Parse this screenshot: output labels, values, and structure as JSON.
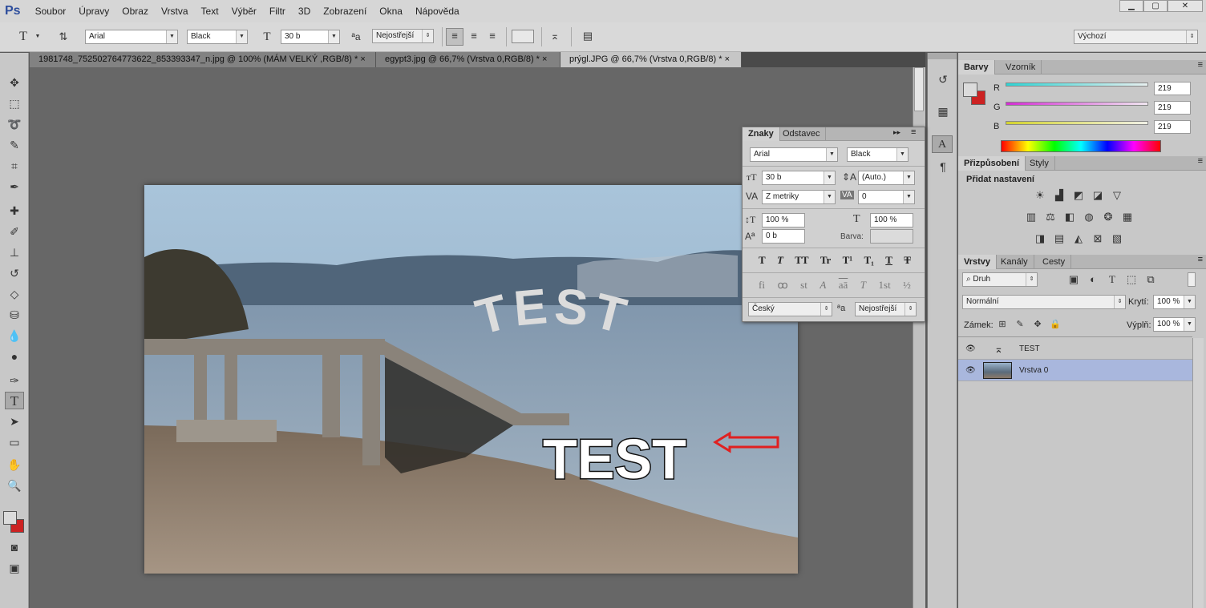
{
  "app": {
    "logo": "Ps"
  },
  "menu": [
    "Soubor",
    "Úpravy",
    "Obraz",
    "Vrstva",
    "Text",
    "Výběr",
    "Filtr",
    "3D",
    "Zobrazení",
    "Okna",
    "Nápověda"
  ],
  "window_controls": {
    "minimize": "▁",
    "maximize": "▢",
    "close": "✕"
  },
  "options": {
    "font_family": "Arial",
    "font_style": "Black",
    "font_size": "30 b",
    "antialias": "Nejostřejší",
    "workspace": "Výchozí"
  },
  "tabs": [
    {
      "label": "1981748_752502764773622_853393347_n.jpg @ 100% (MÁM VELKÝ ,RGB/8) *",
      "close": "×"
    },
    {
      "label": "egypt3.jpg @ 66,7% (Vrstva 0,RGB/8) *",
      "close": "×"
    },
    {
      "label": "prýgl.JPG @ 66,7% (Vrstva 0,RGB/8) *",
      "close": "×"
    }
  ],
  "canvas": {
    "arc_text": "TEST",
    "flat_text": "TEST"
  },
  "char_panel": {
    "tabs": [
      "Znaky",
      "Odstavec"
    ],
    "font_family": "Arial",
    "font_style": "Black",
    "size": "30 b",
    "leading": "(Auto.)",
    "kerning": "Z metriky",
    "tracking": "0",
    "vscale": "100 %",
    "hscale": "100 %",
    "baseline": "0 b",
    "color_label": "Barva:",
    "language": "Český",
    "antialias": "Nejostřejší",
    "style_buttons": [
      "T",
      "T",
      "TT",
      "Tr",
      "T¹",
      "T₁",
      "T",
      "T"
    ],
    "ot_buttons": [
      "fi",
      "ꝏ",
      "st",
      "A",
      "aā",
      "T",
      "1st",
      "½"
    ]
  },
  "color_panel": {
    "tabs": [
      "Barvy",
      "Vzorník"
    ],
    "channels": [
      {
        "label": "R",
        "value": "219"
      },
      {
        "label": "G",
        "value": "219"
      },
      {
        "label": "B",
        "value": "219"
      }
    ],
    "foreground": "#dbdbdb",
    "background": "#cc2222"
  },
  "adjust_panel": {
    "tabs": [
      "Přizpůsobení",
      "Styly"
    ],
    "title": "Přidat nastavení"
  },
  "layers_panel": {
    "tabs": [
      "Vrstvy",
      "Kanály",
      "Cesty"
    ],
    "filter": "Druh",
    "blend": "Normální",
    "opacity_label": "Krytí:",
    "opacity": "100 %",
    "lock_label": "Zámek:",
    "fill_label": "Výplň:",
    "fill": "100 %",
    "layers": [
      {
        "name": "TEST",
        "kind": "text"
      },
      {
        "name": "Vrstva 0",
        "kind": "image",
        "selected": true
      }
    ]
  }
}
